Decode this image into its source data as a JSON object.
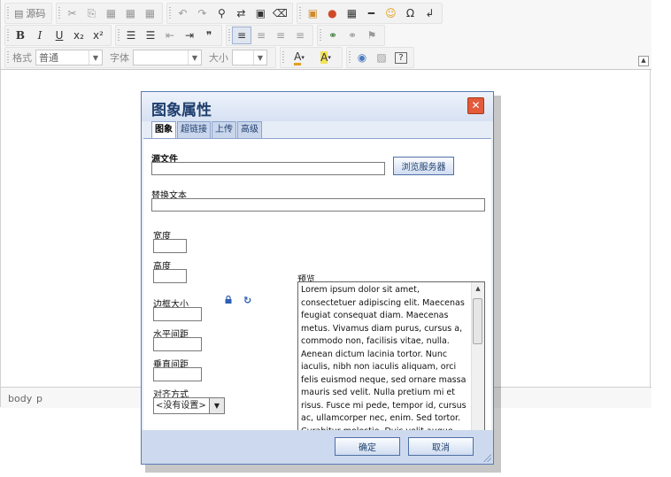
{
  "toolbar": {
    "source_label": "源码",
    "format_label": "格式",
    "format_value": "普通",
    "font_label": "字体",
    "font_value": "",
    "size_label": "大小",
    "size_value": ""
  },
  "statusbar": {
    "path": [
      "body",
      "p"
    ]
  },
  "dialog": {
    "title": "图象属性",
    "close_label": "✕",
    "tabs": [
      "图象",
      "超链接",
      "上传",
      "高级"
    ],
    "source_label": "源文件",
    "source_value": "",
    "browse_label": "浏览服务器",
    "alt_label": "替换文本",
    "alt_value": "",
    "width_label": "宽度",
    "height_label": "高度",
    "border_label": "边框大小",
    "hspace_label": "水平间距",
    "vspace_label": "垂直间距",
    "align_label": "对齐方式",
    "align_value": "<没有设置>",
    "preview_label": "预览",
    "preview_text": "Lorem ipsum dolor sit amet, consectetuer adipiscing elit. Maecenas feugiat consequat diam. Maecenas metus. Vivamus diam purus, cursus a, commodo non, facilisis vitae, nulla. Aenean dictum lacinia tortor. Nunc iaculis, nibh non iaculis aliquam, orci felis euismod neque, sed ornare massa mauris sed velit. Nulla pretium mi et risus. Fusce mi pede, tempor id, cursus ac, ullamcorper nec, enim. Sed tortor. Curabitur molestie. Duis velit augue, condimentum at, ultrices a, luctus ut, orci.",
    "ok_label": "确定",
    "cancel_label": "取消"
  }
}
